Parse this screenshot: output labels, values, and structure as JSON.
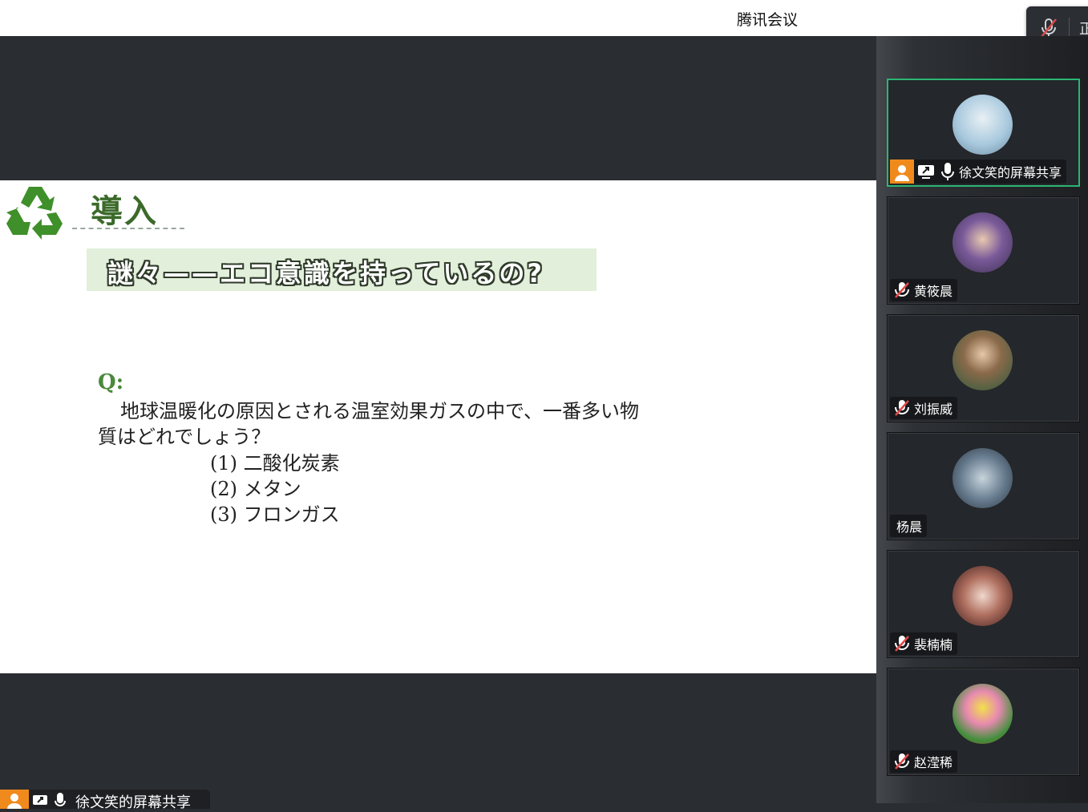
{
  "window": {
    "title": "腾讯会议"
  },
  "top_mic": {
    "icon": "mic-muted-icon",
    "truncated_label": "正"
  },
  "slide": {
    "title": "導入",
    "banner": "謎々——エコ意識を持っているの?",
    "question_label": "Q:",
    "question": "地球温暖化の原因とされる温室効果ガスの中で、一番多い物質はどれでしょう？",
    "options": [
      "(1) 二酸化炭素",
      "(2) メタン",
      "(3) フロンガス"
    ]
  },
  "share_tag": {
    "label": "徐文笑的屏幕共享"
  },
  "participants": [
    {
      "name": "徐文笑的屏幕共享",
      "mic": "on",
      "host": true,
      "sharing": true,
      "avatar_color": "#a9c9de"
    },
    {
      "name": "黄筱晨",
      "mic": "muted",
      "avatar_color": "#5a4a78"
    },
    {
      "name": "刘振威",
      "mic": "muted",
      "avatar_color": "#7a5a3a"
    },
    {
      "name": "杨晨",
      "mic": "none",
      "avatar_color": "#6a7f92"
    },
    {
      "name": "裴楠楠",
      "mic": "muted",
      "avatar_color": "#b07060"
    },
    {
      "name": "赵滢稀",
      "mic": "muted",
      "avatar_color": "#3f8f3a"
    }
  ]
}
